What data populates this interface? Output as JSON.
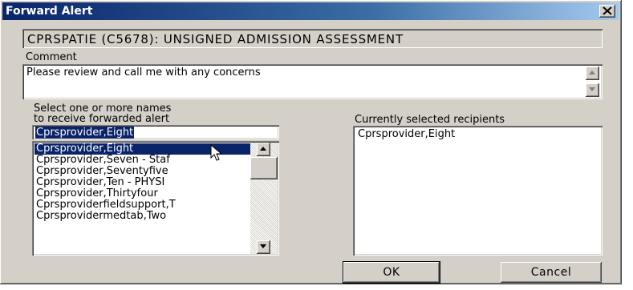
{
  "window": {
    "title": "Forward Alert",
    "close_glyph": "×"
  },
  "alert": {
    "text": "CPRSPATIE (C5678): UNSIGNED ADMISSION ASSESSMENT"
  },
  "comment": {
    "label": "Comment",
    "value": "Please review and call me with any concerns"
  },
  "select": {
    "label_line1": "Select one or more names",
    "label_line2": "to receive forwarded alert",
    "input_value": "Cprsprovider,Eight",
    "items": [
      {
        "label": "Cprsprovider,Eight",
        "selected": true
      },
      {
        "label": "Cprsprovider,Seven - Staf",
        "selected": false
      },
      {
        "label": "Cprsprovider,Seventyfive",
        "selected": false
      },
      {
        "label": "Cprsprovider,Ten - PHYSI",
        "selected": false
      },
      {
        "label": "Cprsprovider,Thirtyfour",
        "selected": false
      },
      {
        "label": "Cprsproviderfieldsupport,T",
        "selected": false
      },
      {
        "label": "Cprsprovidermedtab,Two",
        "selected": false
      }
    ]
  },
  "recipients": {
    "label": "Currently selected recipients",
    "items": [
      "Cprsprovider,Eight"
    ]
  },
  "buttons": {
    "ok": "OK",
    "cancel": "Cancel"
  },
  "icons": {
    "close": "close-icon",
    "scroll_up": "scroll-up-arrow-icon",
    "scroll_down": "scroll-down-arrow-icon",
    "cursor": "mouse-pointer-icon"
  },
  "colors": {
    "title_bar": "#0a246a",
    "face": "#d4d0c8",
    "selection": "#0a246a"
  }
}
